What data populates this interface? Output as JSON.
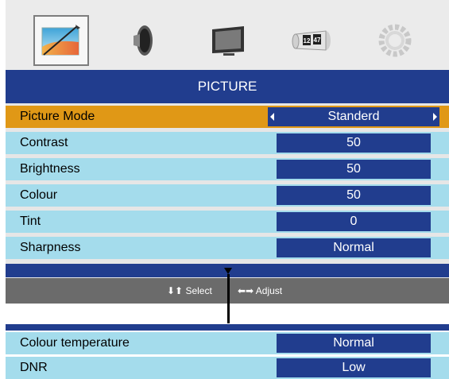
{
  "icons": [
    {
      "name": "picture-icon",
      "selected": true
    },
    {
      "name": "sound-icon",
      "selected": false
    },
    {
      "name": "screen-icon",
      "selected": false
    },
    {
      "name": "time-icon",
      "selected": false,
      "text_a": "12",
      "text_b": "47"
    },
    {
      "name": "setup-icon",
      "selected": false
    }
  ],
  "menu": {
    "title": "PICTURE",
    "rows": [
      {
        "label": "Picture Mode",
        "value": "Standerd"
      },
      {
        "label": "Contrast",
        "value": "50"
      },
      {
        "label": "Brightness",
        "value": "50"
      },
      {
        "label": "Colour",
        "value": "50"
      },
      {
        "label": "Tint",
        "value": "0"
      },
      {
        "label": "Sharpness",
        "value": "Normal"
      }
    ]
  },
  "help": {
    "select": "Select",
    "adjust": "Adjust"
  },
  "continued": {
    "rows": [
      {
        "label": "Colour temperature",
        "value": "Normal"
      },
      {
        "label": "DNR",
        "value": "Low"
      }
    ]
  },
  "colors": {
    "blue": "#213d8e",
    "row": "#a4dcec",
    "highlight": "#e09816",
    "help": "#6b6b6b"
  }
}
